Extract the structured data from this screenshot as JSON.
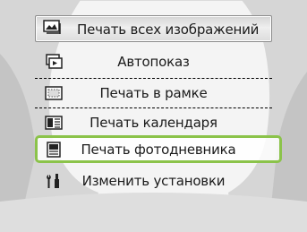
{
  "menu": {
    "items": [
      {
        "label": "Печать всех изображений"
      },
      {
        "label": "Автопоказ"
      },
      {
        "label": "Печать в рамке"
      },
      {
        "label": "Печать календаря"
      },
      {
        "label": "Печать фотодневника"
      },
      {
        "label": "Изменить установки"
      }
    ],
    "selected_index": 4
  },
  "colors": {
    "highlight": "#8bc34a",
    "background": "#f2f2f2",
    "silhouette": "#c4c4c4"
  },
  "icons": [
    "photos-icon",
    "slideshow-icon",
    "frame-icon",
    "calendar-icon",
    "diary-icon",
    "settings-icon"
  ]
}
